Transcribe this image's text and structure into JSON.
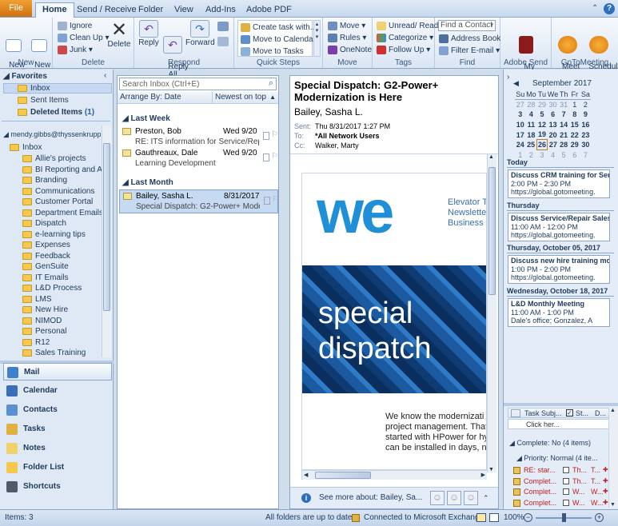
{
  "tabs": [
    "File",
    "Home",
    "Send / Receive",
    "Folder",
    "View",
    "Add-Ins",
    "Adobe PDF"
  ],
  "ribbon": {
    "new": {
      "new_email": "New\nE-mail",
      "new_items": "New\nItems ▾",
      "label": "New"
    },
    "delete": {
      "ignore": "Ignore",
      "clean_up": "Clean Up ▾",
      "junk": "Junk ▾",
      "delete": "Delete",
      "label": "Delete"
    },
    "respond": {
      "reply": "Reply",
      "reply_all": "Reply\nAll",
      "forward": "Forward",
      "label": "Respond"
    },
    "quicksteps": {
      "items": [
        "Create task with...",
        "Move to Calendar",
        "Move to Tasks"
      ],
      "label": "Quick Steps"
    },
    "move": {
      "move": "Move ▾",
      "rules": "Rules ▾",
      "onenote": "OneNote",
      "label": "Move"
    },
    "tags": {
      "unread": "Unread/ Read",
      "categorize": "Categorize ▾",
      "follow": "Follow Up ▾",
      "label": "Tags"
    },
    "find": {
      "find_contact": "Find a Contact",
      "address_book": "Address Book",
      "filter": "Filter E-mail ▾",
      "label": "Find"
    },
    "adobe": {
      "my_account": "My\nAccount ▾",
      "label": "Adobe Send"
    },
    "gotomeeting": {
      "meet_now": "Meet\nNow",
      "schedule": "Schedule\nMeeting",
      "label": "GoToMeeting"
    }
  },
  "nav": {
    "favorites_title": "Favorites",
    "favorites": [
      {
        "name": "Inbox"
      },
      {
        "name": "Sent Items"
      },
      {
        "name": "Deleted Items",
        "count": "(1)"
      }
    ],
    "account": "mendy.gibbs@thyssenkrupp",
    "inbox": "Inbox",
    "folders": [
      "Allie's projects",
      "BI Reporting and Ana",
      "Branding",
      "Communications",
      "Customer Portal",
      "Department Emails",
      "Dispatch",
      "e-learning tips",
      "Expenses",
      "Feedback",
      "GenSuite",
      "IT Emails",
      "L&D Process",
      "LMS",
      "New Hire",
      "NIMOD",
      "Personal",
      "R12",
      "Sales Training"
    ],
    "buttons": [
      "Mail",
      "Calendar",
      "Contacts",
      "Tasks",
      "Notes",
      "Folder List",
      "Shortcuts"
    ]
  },
  "list": {
    "search_placeholder": "Search Inbox (Ctrl+E)",
    "arrange": "Arrange By: Date",
    "order": "Newest on top",
    "groups": {
      "last_week": "Last Week",
      "last_month": "Last Month"
    },
    "messages": [
      {
        "from": "Preston, Bob",
        "date": "Wed 9/20",
        "subject": "RE: ITS information for Service/Repai..."
      },
      {
        "from": "Gauthreaux, Dale",
        "date": "Wed 9/20",
        "subject": "Learning Development"
      },
      {
        "from": "Bailey, Sasha L.",
        "date": "8/31/2017",
        "subject": "Special Dispatch: G2-Power+ Moder..."
      }
    ]
  },
  "reading": {
    "subject": "Special Dispatch: G2-Power+ Modernization is Here",
    "from": "Bailey, Sasha L.",
    "sent_label": "Sent:",
    "sent": "Thu 8/31/2017 1:27 PM",
    "to_label": "To:",
    "to": "*All Network Users",
    "cc_label": "Cc:",
    "cc": "Walker, Marty",
    "banner_logo": "we",
    "banner_side": [
      "Elevator T",
      "Newslette",
      "Business"
    ],
    "banner_line1": "special",
    "banner_line2": "dispatch",
    "body": [
      "We know the modernizati",
      "project management. That",
      "started with HPower for hy",
      "can be installed in days, no"
    ],
    "see_more": "See more about: Bailey, Sa..."
  },
  "todo": {
    "month": "September 2017",
    "weekdays": [
      "Su",
      "Mo",
      "Tu",
      "We",
      "Th",
      "Fr",
      "Sa"
    ],
    "weeks": [
      [
        "27",
        "28",
        "29",
        "30",
        "31",
        "1",
        "2"
      ],
      [
        "3",
        "4",
        "5",
        "6",
        "7",
        "8",
        "9"
      ],
      [
        "10",
        "11",
        "12",
        "13",
        "14",
        "15",
        "16"
      ],
      [
        "17",
        "18",
        "19",
        "20",
        "21",
        "22",
        "23"
      ],
      [
        "24",
        "25",
        "26",
        "27",
        "28",
        "29",
        "30"
      ],
      [
        "1",
        "2",
        "3",
        "4",
        "5",
        "6",
        "7"
      ]
    ],
    "days": [
      {
        "header": "Today",
        "title": "Discuss CRM training for Servic",
        "time": "2:00 PM - 2:30 PM",
        "loc": "https://global.gotomeeting."
      },
      {
        "header": "Thursday",
        "title": "Discuss Service/Repair Sales N",
        "time": "11:00 AM - 12:00 PM",
        "loc": "https://global.gotomeeting."
      },
      {
        "header": "Thursday, October 05, 2017",
        "title": "Discuss new hire training mod",
        "time": "1:00 PM - 2:00 PM",
        "loc": "https://global.gotomeeting."
      },
      {
        "header": "Wednesday, October 18, 2017",
        "title": "L&D Monthly Meeting",
        "time": "11:00 AM - 1:00 PM",
        "loc": "Dale's office; Gonzalez, A"
      }
    ],
    "task_cols": [
      "Task Subj...",
      "St...",
      "D..."
    ],
    "click_here": "Click her...",
    "complete_group": "Complete: No (4 items)",
    "priority_group": "Priority: Normal (4 ite...",
    "tasks": [
      {
        "subject": "RE: star...",
        "c2": "Th...",
        "c3": "T..."
      },
      {
        "subject": "Complet...",
        "c2": "Th...",
        "c3": "T..."
      },
      {
        "subject": "Complet...",
        "c2": "W...",
        "c3": "W..."
      },
      {
        "subject": "Complet...",
        "c2": "W...",
        "c3": "W..."
      }
    ]
  },
  "status": {
    "items": "Items: 3",
    "sync": "All folders are up to date.",
    "connected": "Connected to Microsoft Exchange",
    "zoom": "100%"
  }
}
